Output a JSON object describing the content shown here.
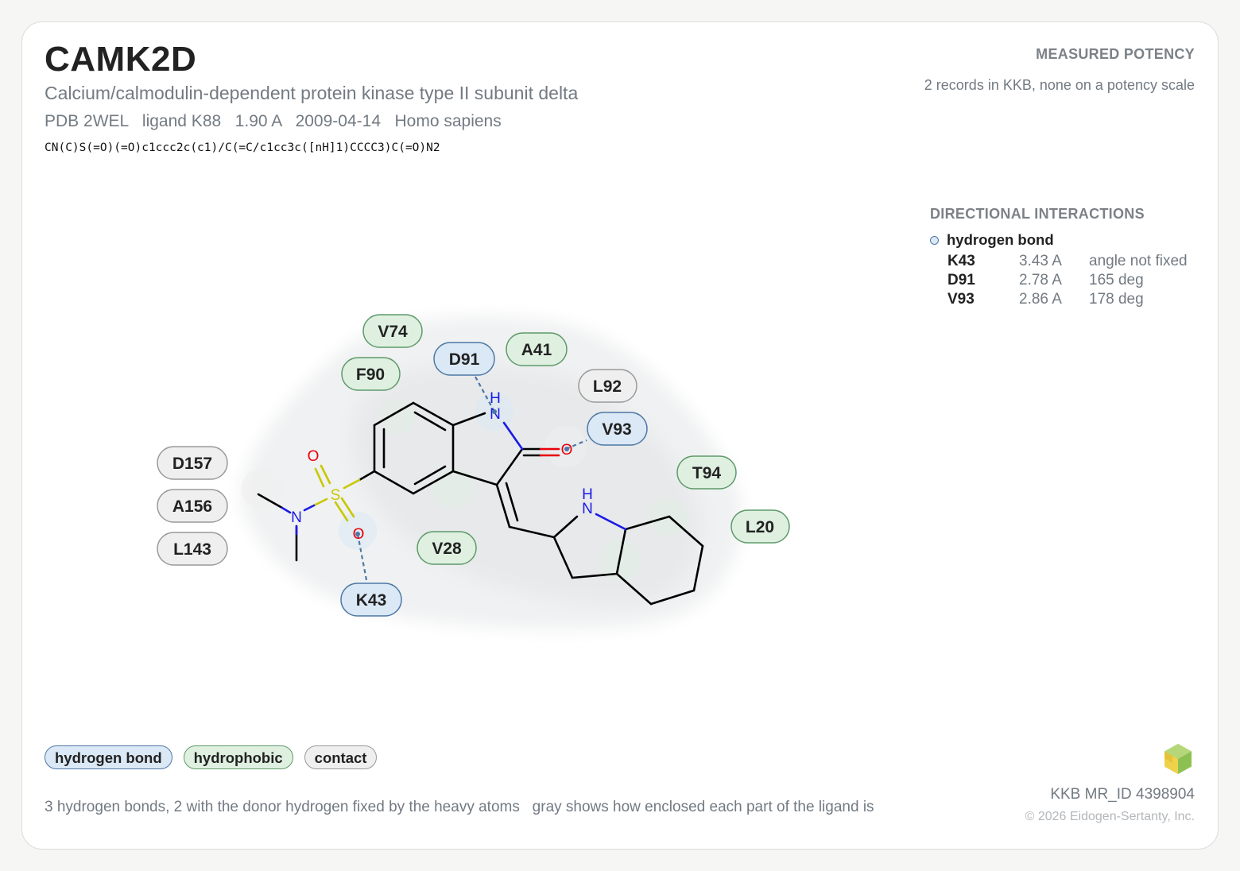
{
  "target": {
    "name": "CAMK2D",
    "full_name": "Calcium/calmodulin-dependent protein kinase type II subunit delta",
    "meta": "PDB 2WEL   ligand K88   1.90 A   2009-04-14   Homo sapiens",
    "smiles": "CN(C)S(=O)(=O)c1ccc2c(c1)/C(=C/c1cc3c([nH]1)CCCC3)C(=O)N2"
  },
  "potency": {
    "heading": "MEASURED POTENCY",
    "note": "2 records in KKB, none on a potency scale"
  },
  "interactions": {
    "heading": "DIRECTIONAL INTERACTIONS",
    "type_label": "hydrogen bond",
    "rows": [
      {
        "residue": "K43",
        "distance": "3.43 A",
        "angle": "angle not fixed"
      },
      {
        "residue": "D91",
        "distance": "2.78 A",
        "angle": "165 deg"
      },
      {
        "residue": "V93",
        "distance": "2.86 A",
        "angle": "178 deg"
      }
    ]
  },
  "residues": {
    "V74": "V74",
    "F90": "F90",
    "D91": "D91",
    "A41": "A41",
    "L92": "L92",
    "V93": "V93",
    "T94": "T94",
    "L20": "L20",
    "D157": "D157",
    "A156": "A156",
    "L143": "L143",
    "V28": "V28",
    "K43": "K43"
  },
  "atoms": {
    "O": "O",
    "S": "S",
    "N": "N",
    "H": "H"
  },
  "colors": {
    "hbond": "#dbe8f5",
    "hydrophobic": "#dff0e1",
    "contact": "#efefef",
    "oxygen": "#e8000b",
    "nitrogen": "#1a1ae6",
    "sulfur": "#c8c800"
  },
  "legend": {
    "hbond": "hydrogen bond",
    "hydrophobic": "hydrophobic",
    "contact": "contact"
  },
  "footer": {
    "note": "3 hydrogen bonds, 2 with the donor hydrogen fixed by the heavy atoms   gray shows how enclosed each part of the ligand is",
    "mr_id": "KKB MR_ID 4398904",
    "copyright": "© 2026 Eidogen-Sertanty, Inc."
  }
}
